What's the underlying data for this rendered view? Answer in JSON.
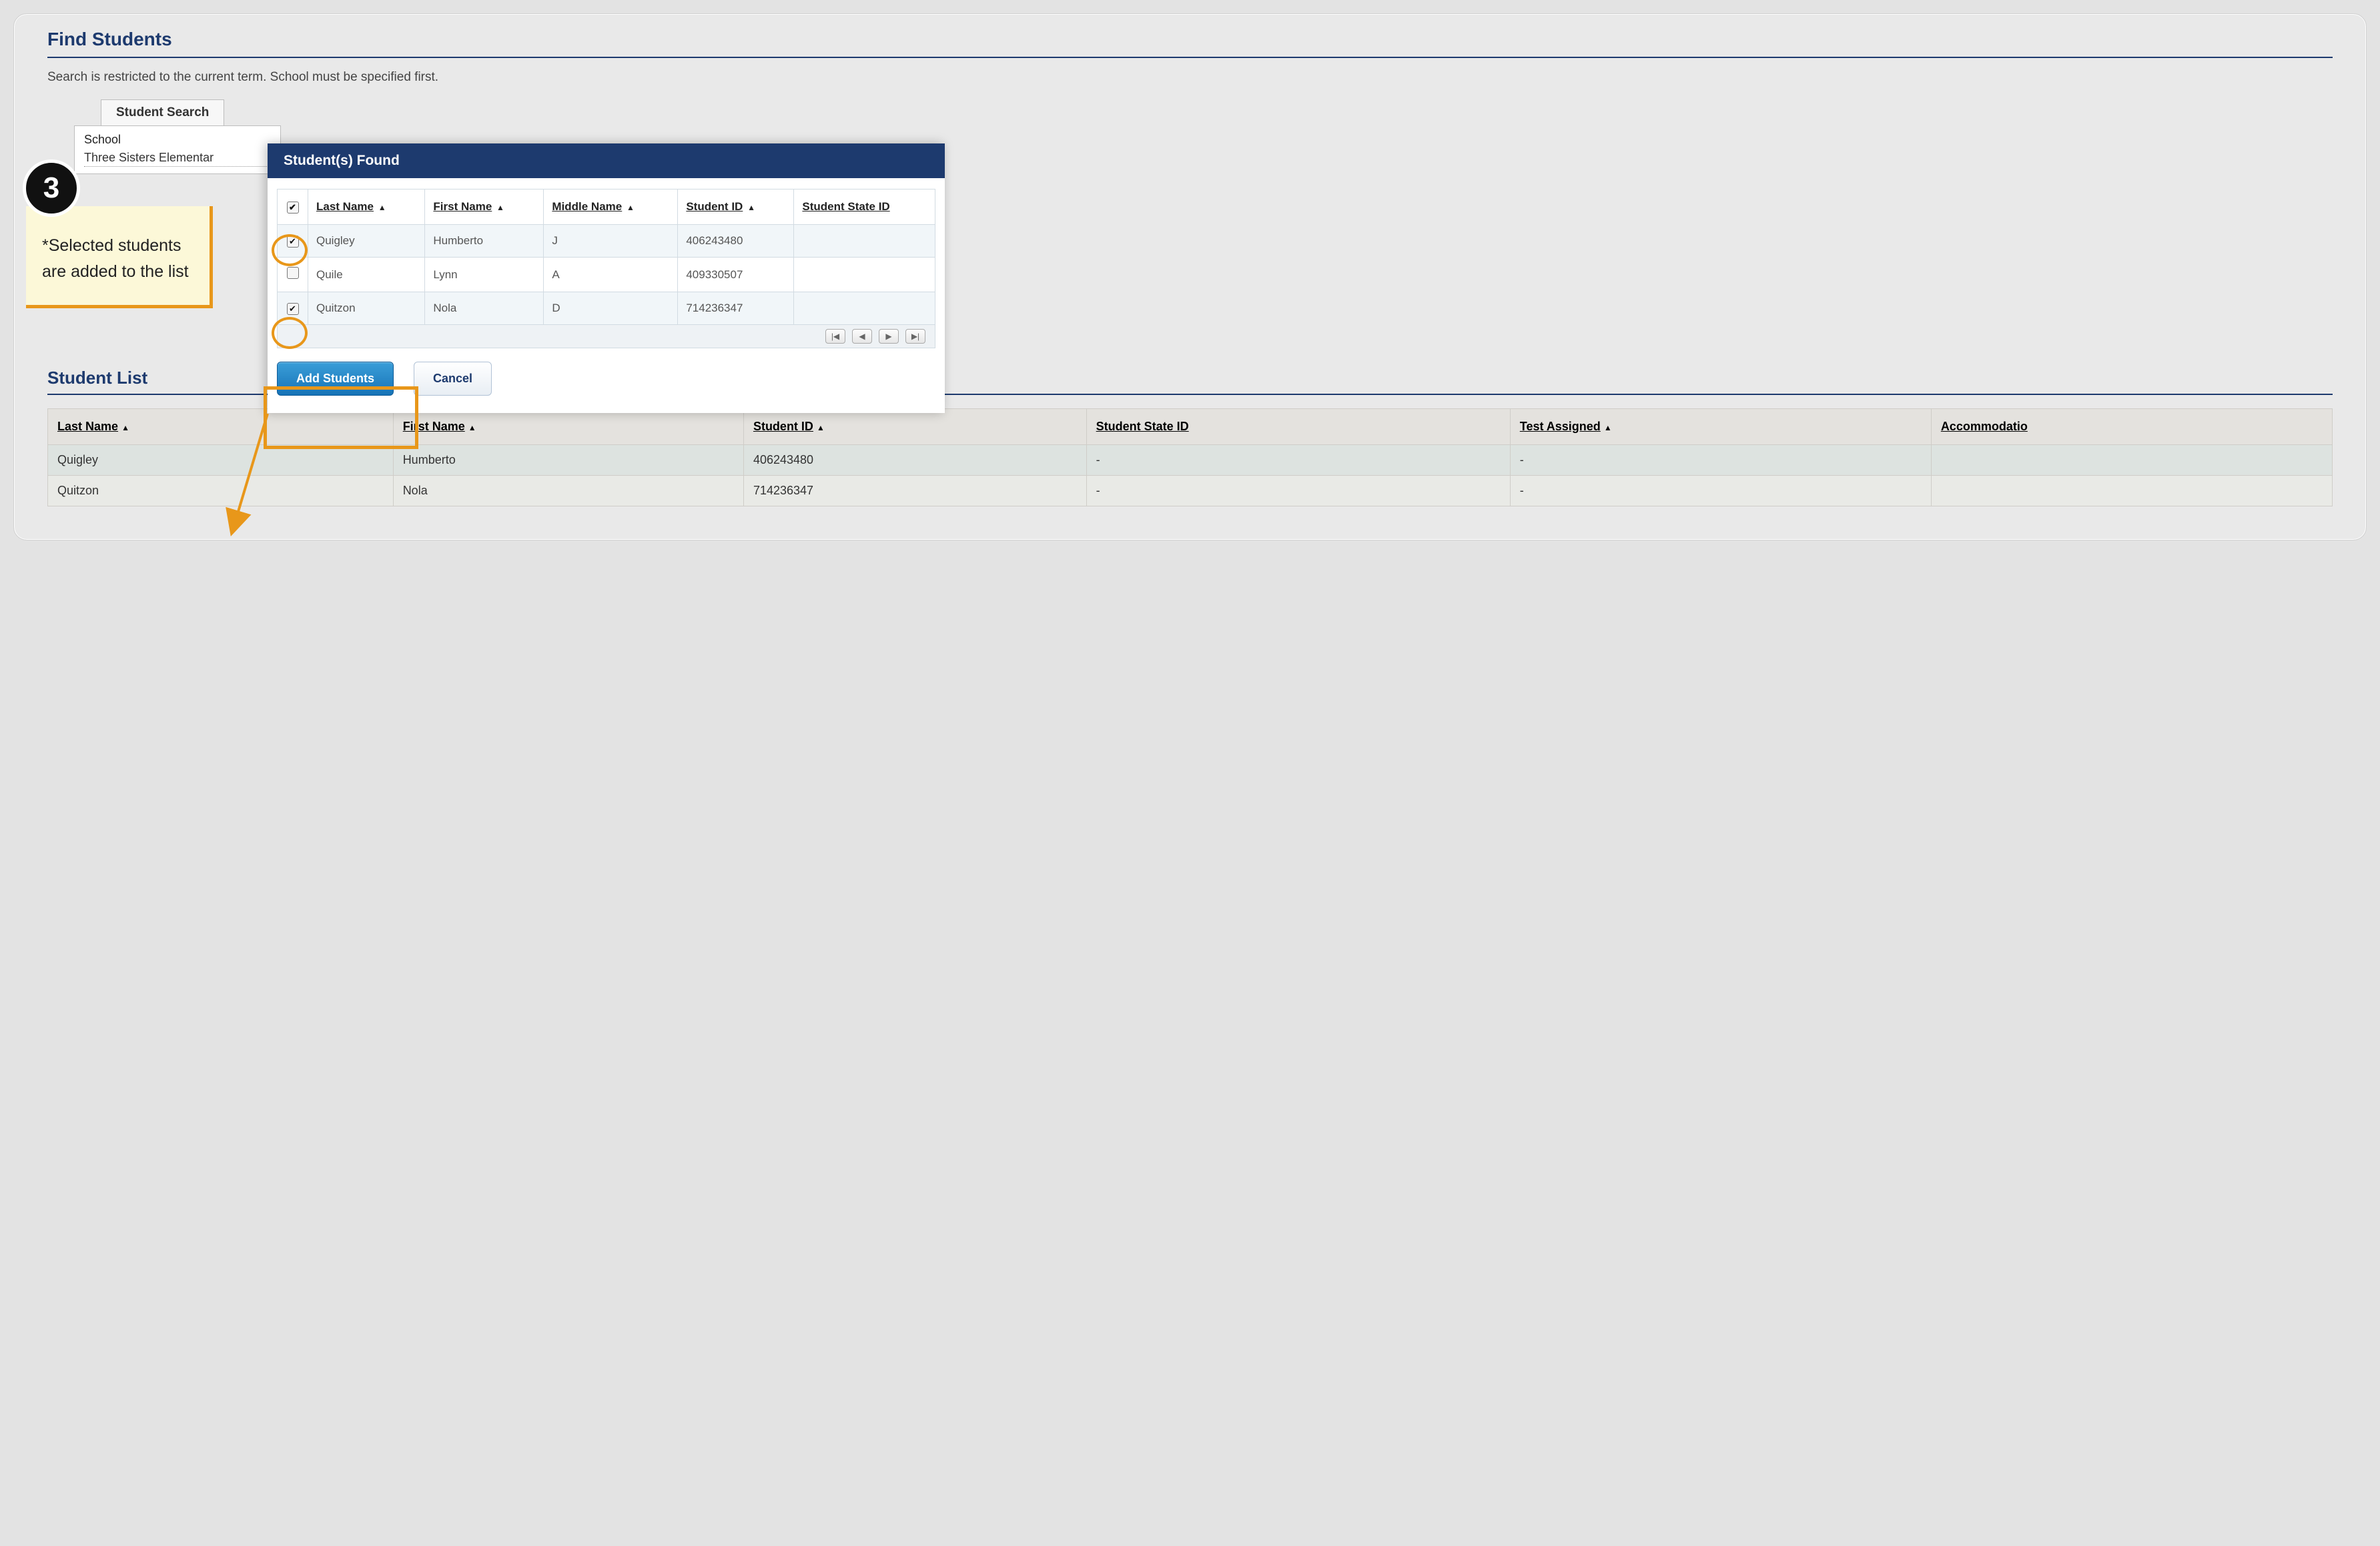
{
  "page": {
    "title": "Find Students",
    "subtext": "Search is restricted to the current term. School must be specified first.",
    "section_title": "Student List"
  },
  "tabs": {
    "student_search": "Student Search"
  },
  "form": {
    "school_label": "School",
    "school_value": "Three Sisters Elementar"
  },
  "modal": {
    "title": "Student(s) Found",
    "headers": {
      "last_name": "Last Name",
      "first_name": "First Name",
      "middle_name": "Middle Name",
      "student_id": "Student ID",
      "student_state_id": "Student State ID"
    },
    "rows": [
      {
        "checked": true,
        "last_name": "Quigley",
        "first_name": "Humberto",
        "middle_name": "J",
        "student_id": "406243480",
        "student_state_id": ""
      },
      {
        "checked": false,
        "last_name": "Quile",
        "first_name": "Lynn",
        "middle_name": "A",
        "student_id": "409330507",
        "student_state_id": ""
      },
      {
        "checked": true,
        "last_name": "Quitzon",
        "first_name": "Nola",
        "middle_name": "D",
        "student_id": "714236347",
        "student_state_id": ""
      }
    ],
    "actions": {
      "add": "Add Students",
      "cancel": "Cancel"
    }
  },
  "list": {
    "headers": {
      "last_name": "Last Name",
      "first_name": "First Name",
      "student_id": "Student ID",
      "student_state_id": "Student State ID",
      "test_assigned": "Test Assigned",
      "accommodation": "Accommodatio"
    },
    "rows": [
      {
        "last_name": "Quigley",
        "first_name": "Humberto",
        "student_id": "406243480",
        "student_state_id": "-",
        "test_assigned": "-",
        "accommodation": ""
      },
      {
        "last_name": "Quitzon",
        "first_name": "Nola",
        "student_id": "714236347",
        "student_state_id": "-",
        "test_assigned": "-",
        "accommodation": ""
      }
    ]
  },
  "annotation": {
    "step": "3",
    "text": "*Selected students are added to the list"
  }
}
